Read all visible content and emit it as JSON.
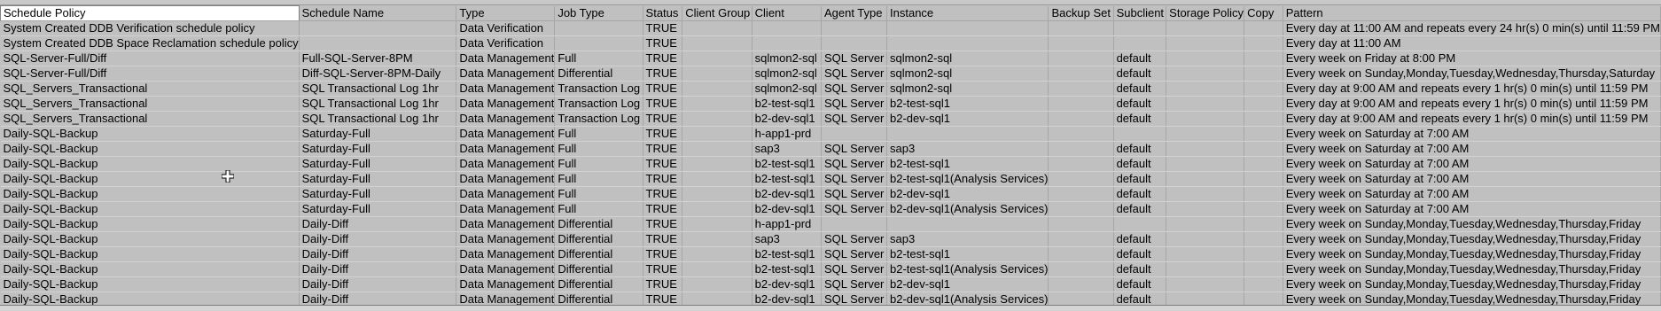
{
  "columns": [
    "Schedule Policy",
    "Schedule Name",
    "Type",
    "Job Type",
    "Status",
    "Client Group",
    "Client",
    "Agent Type",
    "Instance",
    "Backup Set",
    "Subclient",
    "Storage Policy",
    "Copy",
    "Pattern"
  ],
  "rows": [
    [
      "System Created DDB Verification schedule policy",
      "",
      "Data Verification",
      "",
      "TRUE",
      "",
      "",
      "",
      "",
      "",
      "",
      "",
      "",
      "Every day at 11:00 AM  and repeats every 24 hr(s) 0 min(s) until 11:59 PM"
    ],
    [
      "System Created DDB Space Reclamation schedule policy",
      "",
      "Data Verification",
      "",
      "TRUE",
      "",
      "",
      "",
      "",
      "",
      "",
      "",
      "",
      "Every day at 11:00 AM"
    ],
    [
      "SQL-Server-Full/Diff",
      "Full-SQL-Server-8PM",
      "Data Management",
      "Full",
      "TRUE",
      "",
      "sqlmon2-sql",
      "SQL Server",
      "sqlmon2-sql",
      "",
      "default",
      "",
      "",
      "Every week on Friday at 8:00 PM"
    ],
    [
      "SQL-Server-Full/Diff",
      "Diff-SQL-Server-8PM-Daily",
      "Data Management",
      "Differential",
      "TRUE",
      "",
      "sqlmon2-sql",
      "SQL Server",
      "sqlmon2-sql",
      "",
      "default",
      "",
      "",
      "Every week on Sunday,Monday,Tuesday,Wednesday,Thursday,Saturday"
    ],
    [
      "SQL_Servers_Transactional",
      "SQL Transactional Log 1hr",
      "Data Management",
      "Transaction Log",
      "TRUE",
      "",
      "sqlmon2-sql",
      "SQL Server",
      "sqlmon2-sql",
      "",
      "default",
      "",
      "",
      "Every day at 9:00 AM  and repeats every 1 hr(s) 0 min(s) until 11:59 PM"
    ],
    [
      "SQL_Servers_Transactional",
      "SQL Transactional Log 1hr",
      "Data Management",
      "Transaction Log",
      "TRUE",
      "",
      "b2-test-sql1",
      "SQL Server",
      "b2-test-sql1",
      "",
      "default",
      "",
      "",
      "Every day at 9:00 AM  and repeats every 1 hr(s) 0 min(s) until 11:59 PM"
    ],
    [
      "SQL_Servers_Transactional",
      "SQL Transactional Log 1hr",
      "Data Management",
      "Transaction Log",
      "TRUE",
      "",
      "b2-dev-sql1",
      "SQL Server",
      "b2-dev-sql1",
      "",
      "default",
      "",
      "",
      "Every day at 9:00 AM  and repeats every 1 hr(s) 0 min(s) until 11:59 PM"
    ],
    [
      "Daily-SQL-Backup",
      "Saturday-Full",
      "Data Management",
      "Full",
      "TRUE",
      "",
      "h-app1-prd",
      "",
      "",
      "",
      "",
      "",
      "",
      "Every week on Saturday at 7:00 AM"
    ],
    [
      "Daily-SQL-Backup",
      "Saturday-Full",
      "Data Management",
      "Full",
      "TRUE",
      "",
      "sap3",
      "SQL Server",
      "sap3",
      "",
      "default",
      "",
      "",
      "Every week on Saturday at 7:00 AM"
    ],
    [
      "Daily-SQL-Backup",
      "Saturday-Full",
      "Data Management",
      "Full",
      "TRUE",
      "",
      "b2-test-sql1",
      "SQL Server",
      "b2-test-sql1",
      "",
      "default",
      "",
      "",
      "Every week on Saturday at 7:00 AM"
    ],
    [
      "Daily-SQL-Backup",
      "Saturday-Full",
      "Data Management",
      "Full",
      "TRUE",
      "",
      "b2-test-sql1",
      "SQL Server",
      "b2-test-sql1(Analysis Services)",
      "",
      "default",
      "",
      "",
      "Every week on Saturday at 7:00 AM"
    ],
    [
      "Daily-SQL-Backup",
      "Saturday-Full",
      "Data Management",
      "Full",
      "TRUE",
      "",
      "b2-dev-sql1",
      "SQL Server",
      "b2-dev-sql1",
      "",
      "default",
      "",
      "",
      "Every week on Saturday at 7:00 AM"
    ],
    [
      "Daily-SQL-Backup",
      "Saturday-Full",
      "Data Management",
      "Full",
      "TRUE",
      "",
      "b2-dev-sql1",
      "SQL Server",
      "b2-dev-sql1(Analysis Services)",
      "",
      "default",
      "",
      "",
      "Every week on Saturday at 7:00 AM"
    ],
    [
      "Daily-SQL-Backup",
      "Daily-Diff",
      "Data Management",
      "Differential",
      "TRUE",
      "",
      "h-app1-prd",
      "",
      "",
      "",
      "",
      "",
      "",
      "Every week on Sunday,Monday,Tuesday,Wednesday,Thursday,Friday"
    ],
    [
      "Daily-SQL-Backup",
      "Daily-Diff",
      "Data Management",
      "Differential",
      "TRUE",
      "",
      "sap3",
      "SQL Server",
      "sap3",
      "",
      "default",
      "",
      "",
      "Every week on Sunday,Monday,Tuesday,Wednesday,Thursday,Friday"
    ],
    [
      "Daily-SQL-Backup",
      "Daily-Diff",
      "Data Management",
      "Differential",
      "TRUE",
      "",
      "b2-test-sql1",
      "SQL Server",
      "b2-test-sql1",
      "",
      "default",
      "",
      "",
      "Every week on Sunday,Monday,Tuesday,Wednesday,Thursday,Friday"
    ],
    [
      "Daily-SQL-Backup",
      "Daily-Diff",
      "Data Management",
      "Differential",
      "TRUE",
      "",
      "b2-test-sql1",
      "SQL Server",
      "b2-test-sql1(Analysis Services)",
      "",
      "default",
      "",
      "",
      "Every week on Sunday,Monday,Tuesday,Wednesday,Thursday,Friday"
    ],
    [
      "Daily-SQL-Backup",
      "Daily-Diff",
      "Data Management",
      "Differential",
      "TRUE",
      "",
      "b2-dev-sql1",
      "SQL Server",
      "b2-dev-sql1",
      "",
      "default",
      "",
      "",
      "Every week on Sunday,Monday,Tuesday,Wednesday,Thursday,Friday"
    ],
    [
      "Daily-SQL-Backup",
      "Daily-Diff",
      "Data Management",
      "Differential",
      "TRUE",
      "",
      "b2-dev-sql1",
      "SQL Server",
      "b2-dev-sql1(Analysis Services)",
      "",
      "default",
      "",
      "",
      "Every week on Sunday,Monday,Tuesday,Wednesday,Thursday,Friday"
    ]
  ],
  "cursor_icon": "cell-select-cross-icon"
}
